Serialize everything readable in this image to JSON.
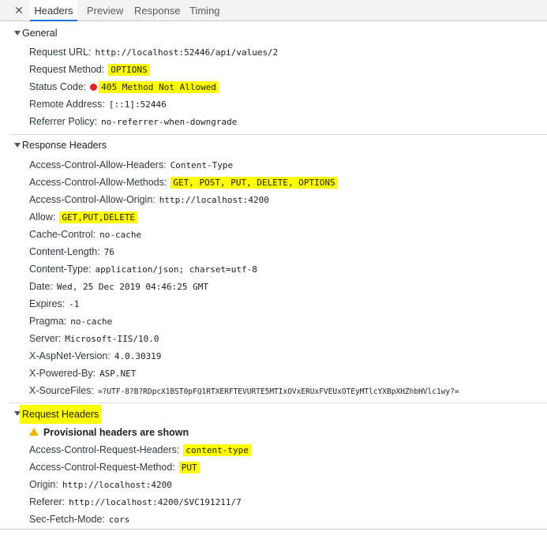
{
  "tabs": [
    {
      "label": "Headers",
      "active": true
    },
    {
      "label": "Preview",
      "active": false
    },
    {
      "label": "Response",
      "active": false
    },
    {
      "label": "Timing",
      "active": false
    }
  ],
  "general": {
    "title": "General",
    "rows": [
      {
        "key": "Request URL:",
        "value": "http://localhost:52446/api/values/2",
        "highlight": false
      },
      {
        "key": "Request Method:",
        "value": "OPTIONS",
        "highlight": true
      },
      {
        "key": "Status Code:",
        "value": "405 Method Not Allowed",
        "highlight": true,
        "status_color": "#e8212a"
      },
      {
        "key": "Remote Address:",
        "value": "[::1]:52446",
        "highlight": false
      },
      {
        "key": "Referrer Policy:",
        "value": "no-referrer-when-downgrade",
        "highlight": false
      }
    ]
  },
  "response_headers": {
    "title": "Response Headers",
    "rows": [
      {
        "key": "Access-Control-Allow-Headers:",
        "value": "Content-Type",
        "highlight": false
      },
      {
        "key": "Access-Control-Allow-Methods:",
        "value": "GET, POST, PUT, DELETE, OPTIONS",
        "highlight": true
      },
      {
        "key": "Access-Control-Allow-Origin:",
        "value": "http://localhost:4200",
        "highlight": false
      },
      {
        "key": "Allow:",
        "value": "GET,PUT,DELETE",
        "highlight": true
      },
      {
        "key": "Cache-Control:",
        "value": "no-cache",
        "highlight": false
      },
      {
        "key": "Content-Length:",
        "value": "76",
        "highlight": false
      },
      {
        "key": "Content-Type:",
        "value": "application/json; charset=utf-8",
        "highlight": false
      },
      {
        "key": "Date:",
        "value": "Wed, 25 Dec 2019 04:46:25 GMT",
        "highlight": false
      },
      {
        "key": "Expires:",
        "value": "-1",
        "highlight": false
      },
      {
        "key": "Pragma:",
        "value": "no-cache",
        "highlight": false
      },
      {
        "key": "Server:",
        "value": "Microsoft-IIS/10.0",
        "highlight": false
      },
      {
        "key": "X-AspNet-Version:",
        "value": "4.0.30319",
        "highlight": false
      },
      {
        "key": "X-Powered-By:",
        "value": "ASP.NET",
        "highlight": false
      },
      {
        "key": "X-SourceFiles:",
        "value": "=?UTF-8?B?RDpcX1BST0pFQ1RTXERFTEVURTE5MTIxOVxERUxFVEUxOTEyMTlcYXBpXHZhbHVlc1wy?=",
        "highlight": false
      }
    ]
  },
  "request_headers": {
    "title": "Request Headers",
    "title_highlight": true,
    "warning": "Provisional headers are shown",
    "warning_icon": "warning-icon",
    "rows": [
      {
        "key": "Access-Control-Request-Headers:",
        "value": "content-type",
        "highlight": true
      },
      {
        "key": "Access-Control-Request-Method:",
        "value": "PUT",
        "highlight": true
      },
      {
        "key": "Origin:",
        "value": "http://localhost:4200",
        "highlight": false
      },
      {
        "key": "Referer:",
        "value": "http://localhost:4200/SVC191211/7",
        "highlight": false
      },
      {
        "key": "Sec-Fetch-Mode:",
        "value": "cors",
        "highlight": false
      }
    ]
  },
  "colors": {
    "highlight": "#ffff00",
    "status_error": "#e8212a",
    "active_tab_underline": "#1a73e8"
  }
}
